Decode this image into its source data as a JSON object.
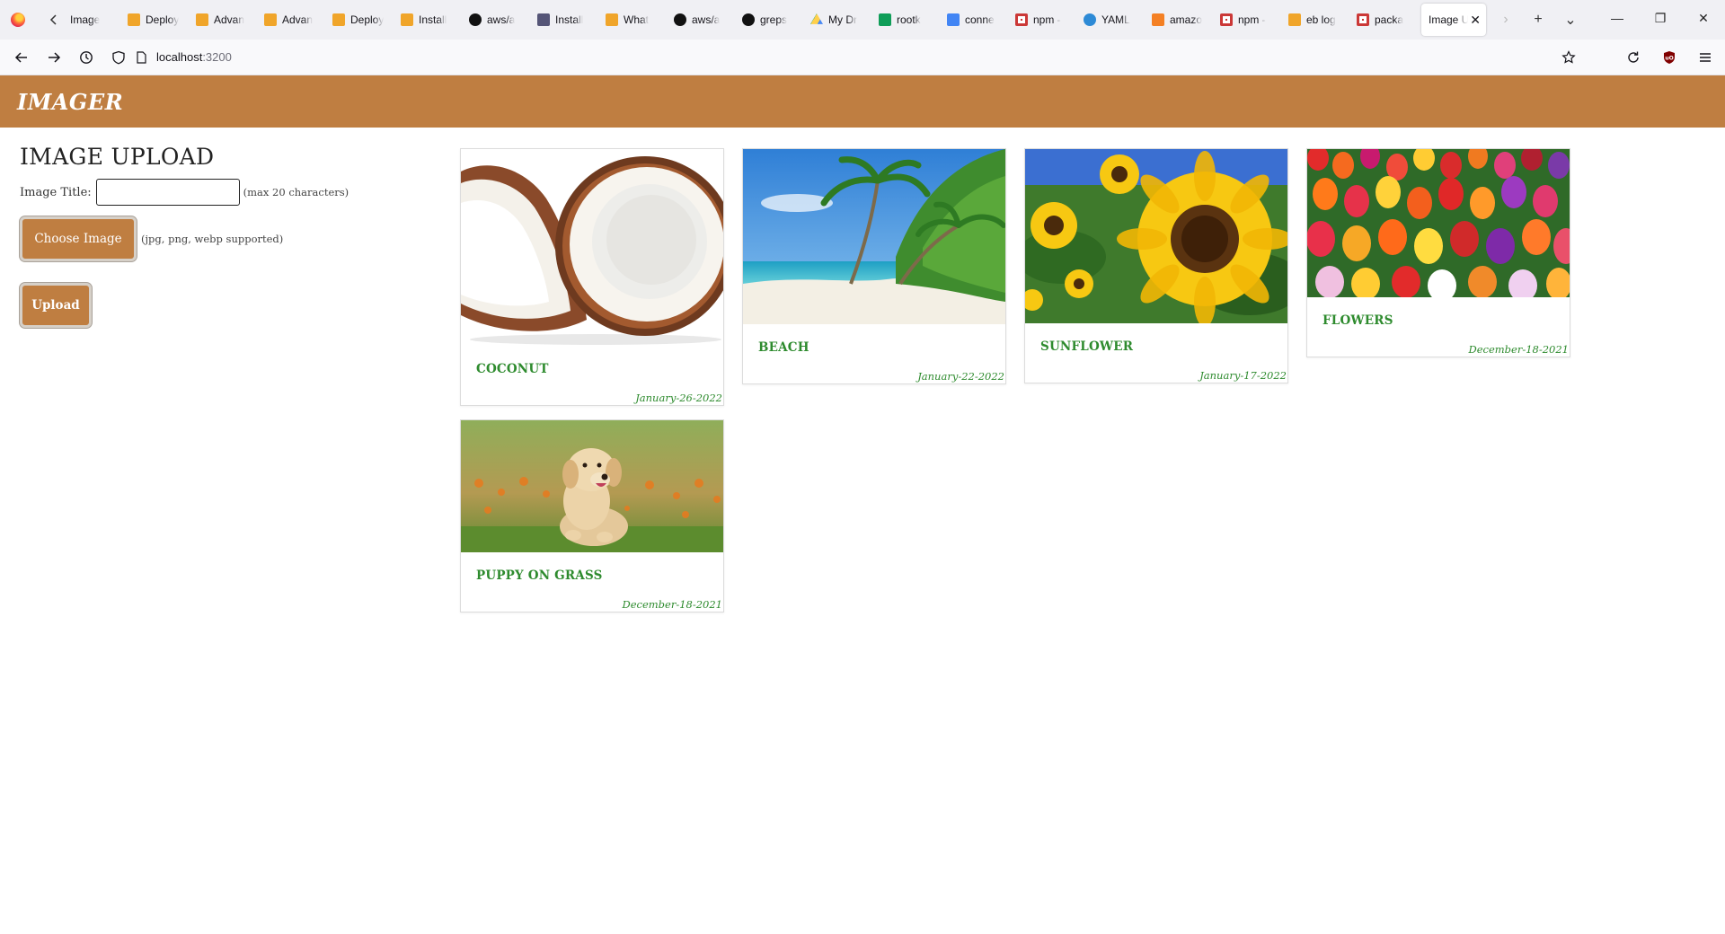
{
  "browser": {
    "tabs": [
      {
        "label": "Image",
        "icon": "back-arrow-icon",
        "color": "#999999"
      },
      {
        "label": "Deploy",
        "icon": "aws-cube-icon",
        "color": "#f0a52a"
      },
      {
        "label": "Advan",
        "icon": "aws-cube-icon",
        "color": "#f0a52a"
      },
      {
        "label": "Advan",
        "icon": "aws-cube-icon",
        "color": "#f0a52a"
      },
      {
        "label": "Deploy",
        "icon": "aws-cube-icon",
        "color": "#f0a52a"
      },
      {
        "label": "Install",
        "icon": "aws-cube-icon",
        "color": "#f0a52a"
      },
      {
        "label": "aws/a",
        "icon": "github-icon",
        "color": "#111111"
      },
      {
        "label": "Install",
        "icon": "document-icon",
        "color": "#555577"
      },
      {
        "label": "What",
        "icon": "aws-cube-icon",
        "color": "#f0a52a"
      },
      {
        "label": "aws/a",
        "icon": "github-icon",
        "color": "#111111"
      },
      {
        "label": "greps",
        "icon": "github-icon",
        "color": "#111111"
      },
      {
        "label": "My Dr",
        "icon": "google-drive-icon",
        "color": "#1fa463"
      },
      {
        "label": "rootk",
        "icon": "google-sheets-icon",
        "color": "#0f9d58"
      },
      {
        "label": "conne",
        "icon": "google-docs-icon",
        "color": "#4285f4"
      },
      {
        "label": "npm -",
        "icon": "npm-icon",
        "color": "#cb3837"
      },
      {
        "label": "YAML",
        "icon": "link-icon",
        "color": "#2d8ad6"
      },
      {
        "label": "amazo",
        "icon": "stackoverflow-icon",
        "color": "#f48024"
      },
      {
        "label": "npm -",
        "icon": "npm-icon",
        "color": "#cb3837"
      },
      {
        "label": "eb log",
        "icon": "aws-cube-icon",
        "color": "#f0a52a"
      },
      {
        "label": "packa",
        "icon": "npm-icon",
        "color": "#cb3837"
      }
    ],
    "active_tab": {
      "label": "Image U",
      "close": "✕"
    },
    "new_tab": "+",
    "list_all_tabs": "⌄",
    "window": {
      "minimize": "—",
      "restore": "❐",
      "close": "✕"
    },
    "url": {
      "host": "localhost",
      "port": ":3200"
    }
  },
  "app": {
    "brand": "IMAGER",
    "brand_color": "#bf7e41",
    "upload": {
      "heading": "IMAGE UPLOAD",
      "title_label": "Image Title:",
      "title_value": "",
      "title_hint": "(max 20 characters)",
      "choose_label": "Choose Image",
      "choose_hint": "(jpg, png, webp supported)",
      "upload_label": "Upload"
    },
    "images": [
      {
        "title": "COCONUT",
        "date": "January-26-2022",
        "subject": "coconut"
      },
      {
        "title": "BEACH",
        "date": "January-22-2022",
        "subject": "beach"
      },
      {
        "title": "SUNFLOWER",
        "date": "January-17-2022",
        "subject": "sunflower"
      },
      {
        "title": "FLOWERS",
        "date": "December-18-2021",
        "subject": "tulips"
      },
      {
        "title": "PUPPY ON GRASS",
        "date": "December-18-2021",
        "subject": "puppy"
      }
    ]
  }
}
